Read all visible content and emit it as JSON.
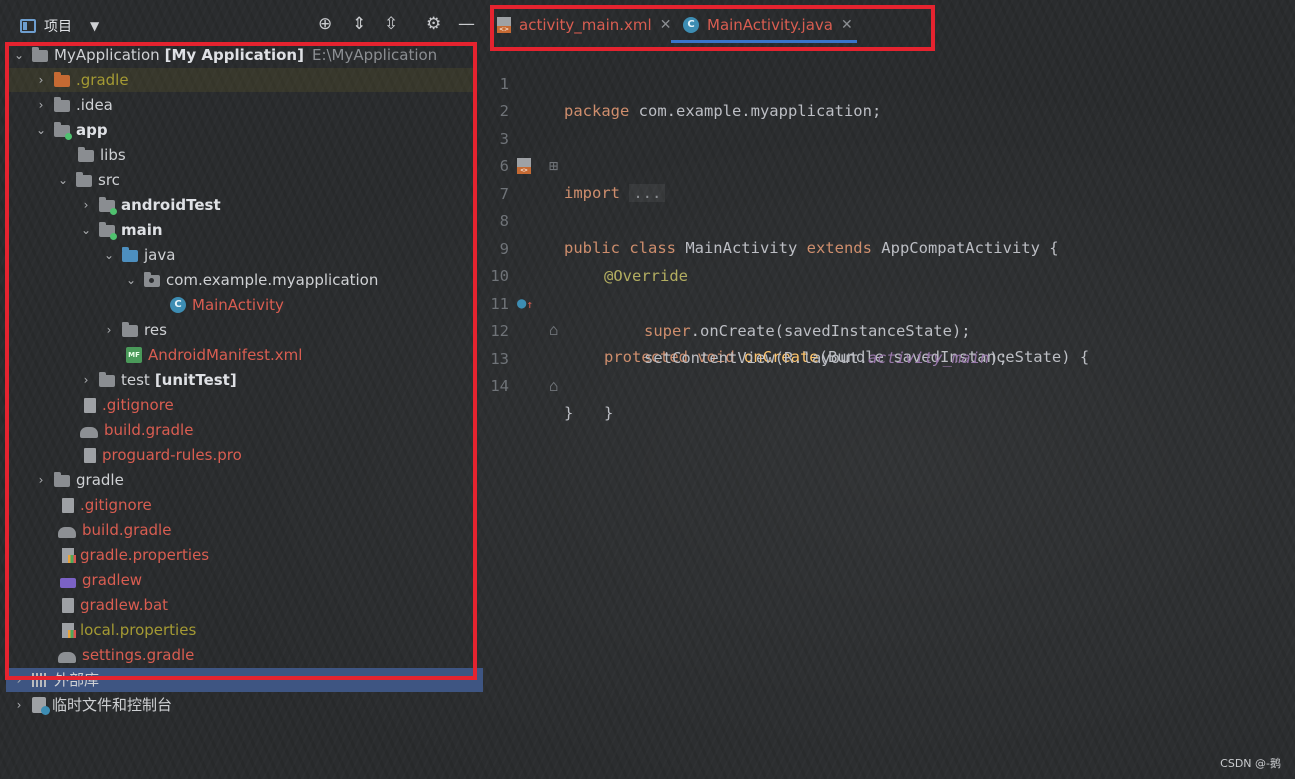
{
  "panel": {
    "title": "项目",
    "icons": [
      "crosshair-icon",
      "expand-all-icon",
      "collapse-all-icon",
      "gear-icon",
      "minimize-icon"
    ]
  },
  "tree": [
    {
      "label": "MyApplication",
      "bold_suffix": "[My Application]",
      "path": "E:\\MyApplication"
    },
    {
      "label": ".gradle"
    },
    {
      "label": ".idea"
    },
    {
      "label": "app"
    },
    {
      "label": "libs"
    },
    {
      "label": "src"
    },
    {
      "label": "androidTest"
    },
    {
      "label": "main"
    },
    {
      "label": "java"
    },
    {
      "label": "com.example.myapplication"
    },
    {
      "label": "MainActivity"
    },
    {
      "label": "res"
    },
    {
      "label": "AndroidManifest.xml"
    },
    {
      "label": "test",
      "bold_suffix": "[unitTest]"
    },
    {
      "label": ".gitignore"
    },
    {
      "label": "build.gradle"
    },
    {
      "label": "proguard-rules.pro"
    },
    {
      "label": "gradle"
    },
    {
      "label": ".gitignore"
    },
    {
      "label": "build.gradle"
    },
    {
      "label": "gradle.properties"
    },
    {
      "label": "gradlew"
    },
    {
      "label": "gradlew.bat"
    },
    {
      "label": "local.properties"
    },
    {
      "label": "settings.gradle"
    },
    {
      "label": "外部库"
    },
    {
      "label": "临时文件和控制台"
    }
  ],
  "tabs": [
    {
      "label": "activity_main.xml"
    },
    {
      "label": "MainActivity.java"
    }
  ],
  "code": {
    "line_numbers": [
      "1",
      "2",
      "3",
      "6",
      "7",
      "8",
      "9",
      "10",
      "11",
      "12",
      "13",
      "14"
    ],
    "l1_kw": "package",
    "l1_rest": " com.example.myapplication;",
    "l3_kw": "import",
    "l3_fold": "...",
    "l7_a": "public class",
    "l7_b": " MainActivity ",
    "l7_c": "extends",
    "l7_d": " AppCompatActivity {",
    "l9": "@Override",
    "l10_a": "protected void ",
    "l10_b": "onCreate",
    "l10_c": "(Bundle savedInstanceState) {",
    "l11_a": "super",
    "l11_b": ".onCreate(savedInstanceState);",
    "l12_a": "setContentView(R.layout.",
    "l12_b": "activity_main",
    "l12_c": ");",
    "l13": "}",
    "l14": "}"
  },
  "watermark": "CSDN @-鹅"
}
